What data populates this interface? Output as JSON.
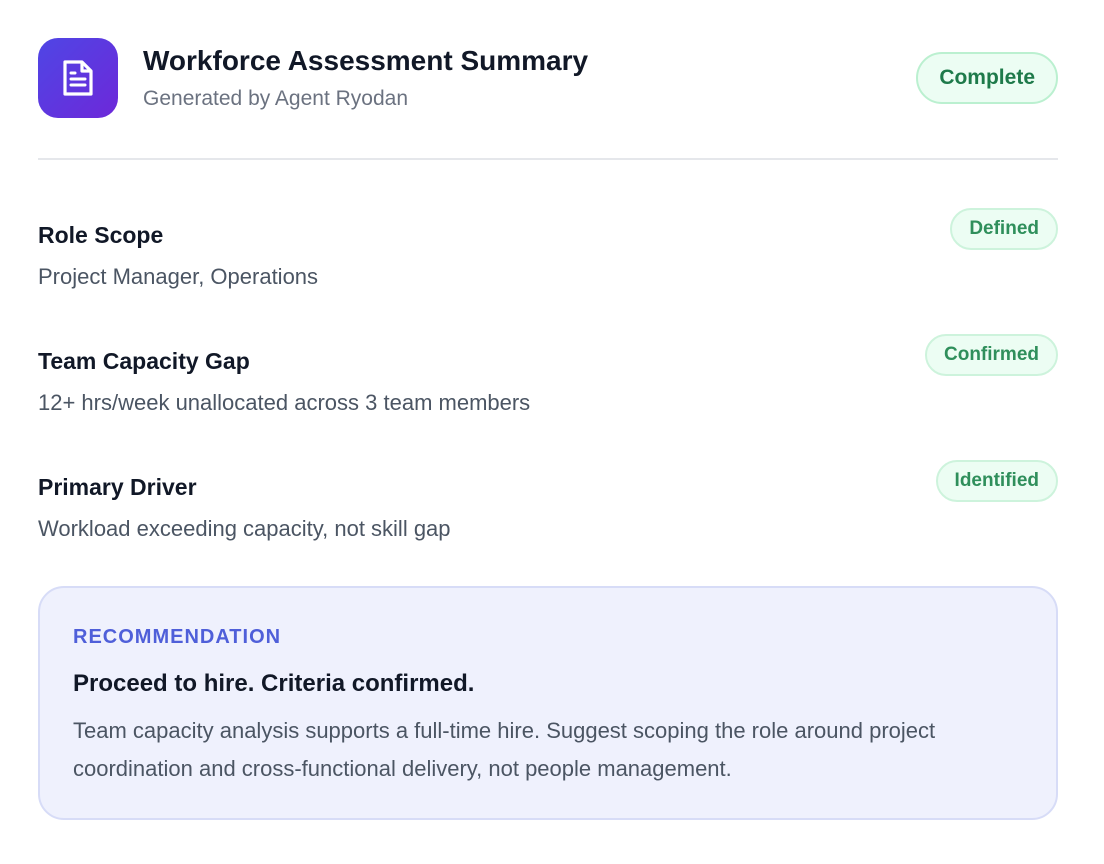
{
  "header": {
    "icon": "document-icon",
    "title": "Workforce Assessment Summary",
    "subtitle": "Generated by Agent Ryodan",
    "status": "Complete"
  },
  "findings": [
    {
      "label": "Role Scope",
      "value": "Project Manager, Operations",
      "badge": "Defined"
    },
    {
      "label": "Team Capacity Gap",
      "value": "12+ hrs/week unallocated across 3 team members",
      "badge": "Confirmed"
    },
    {
      "label": "Primary Driver",
      "value": "Workload exceeding capacity, not skill gap",
      "badge": "Identified"
    }
  ],
  "recommendation": {
    "kicker": "RECOMMENDATION",
    "heading": "Proceed to hire. Criteria confirmed.",
    "body": "Team capacity analysis supports a full-time hire. Suggest scoping the role around project coordination and cross-functional delivery, not people management."
  },
  "colors": {
    "accent": "#4f46e5",
    "success": "#1e7a4a",
    "success_bg": "#ecfdf3",
    "reco_bg": "#eff1fd"
  }
}
